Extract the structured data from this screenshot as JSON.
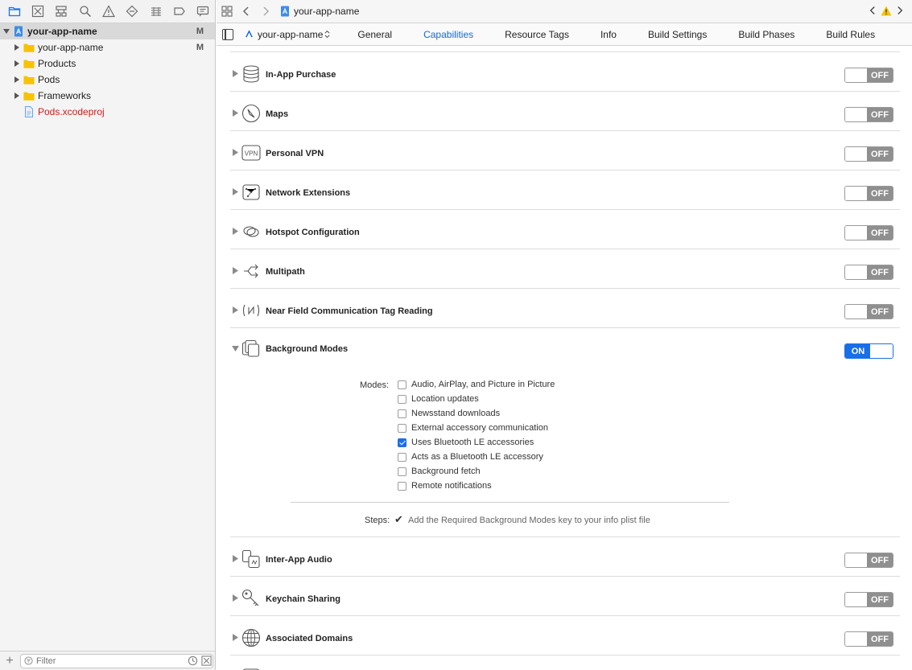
{
  "navigator": {
    "toolbar_icons": [
      "folder-icon",
      "source-control-icon",
      "hierarchy-icon",
      "find-icon",
      "warning-icon",
      "test-icon",
      "debug-icon",
      "breakpoint-icon",
      "report-icon"
    ],
    "tree": [
      {
        "label": "your-app-name",
        "badge": "M",
        "type": "project",
        "level": 0,
        "expanded": true,
        "selected": true
      },
      {
        "label": "your-app-name",
        "badge": "M",
        "type": "folder",
        "level": 1,
        "expanded": false
      },
      {
        "label": "Products",
        "badge": "",
        "type": "folder",
        "level": 1,
        "expanded": false
      },
      {
        "label": "Pods",
        "badge": "",
        "type": "folder",
        "level": 1,
        "expanded": false
      },
      {
        "label": "Frameworks",
        "badge": "",
        "type": "folder",
        "level": 1,
        "expanded": false
      },
      {
        "label": "Pods.xcodeproj",
        "badge": "",
        "type": "file",
        "level": 1,
        "color": "#d01b1b"
      }
    ],
    "filter_placeholder": "Filter"
  },
  "jumpbar": {
    "title": "your-app-name"
  },
  "tabs": {
    "target": "your-app-name",
    "items": [
      "General",
      "Capabilities",
      "Resource Tags",
      "Info",
      "Build Settings",
      "Build Phases",
      "Build Rules"
    ],
    "active": "Capabilities"
  },
  "capabilities": [
    {
      "title": "In-App Purchase",
      "state": "OFF",
      "icon": "coins-icon"
    },
    {
      "title": "Maps",
      "state": "OFF",
      "icon": "compass-icon"
    },
    {
      "title": "Personal VPN",
      "state": "OFF",
      "icon": "vpn-icon"
    },
    {
      "title": "Network Extensions",
      "state": "OFF",
      "icon": "network-extension-icon"
    },
    {
      "title": "Hotspot Configuration",
      "state": "OFF",
      "icon": "hotspot-icon"
    },
    {
      "title": "Multipath",
      "state": "OFF",
      "icon": "multipath-icon"
    },
    {
      "title": "Near Field Communication Tag Reading",
      "state": "OFF",
      "icon": "nfc-icon"
    },
    {
      "title": "Background Modes",
      "state": "ON",
      "icon": "background-modes-icon"
    },
    {
      "title": "Inter-App Audio",
      "state": "OFF",
      "icon": "inter-app-audio-icon"
    },
    {
      "title": "Keychain Sharing",
      "state": "OFF",
      "icon": "keychain-icon"
    },
    {
      "title": "Associated Domains",
      "state": "OFF",
      "icon": "globe-icon"
    },
    {
      "title": "",
      "state": "OFF",
      "icon": "next-capability-icon"
    }
  ],
  "background_modes": {
    "modes_label": "Modes:",
    "modes": [
      {
        "label": "Audio, AirPlay, and Picture in Picture",
        "checked": false
      },
      {
        "label": "Location updates",
        "checked": false
      },
      {
        "label": "Newsstand downloads",
        "checked": false
      },
      {
        "label": "External accessory communication",
        "checked": false
      },
      {
        "label": "Uses Bluetooth LE accessories",
        "checked": true
      },
      {
        "label": "Acts as a Bluetooth LE accessory",
        "checked": false
      },
      {
        "label": "Background fetch",
        "checked": false
      },
      {
        "label": "Remote notifications",
        "checked": false
      }
    ],
    "steps_label": "Steps:",
    "steps_text": "Add the Required Background Modes key to your info plist file"
  },
  "colors": {
    "accent": "#1a6fe8",
    "toggle_off": "#8f8f8f",
    "warning": "#f5c400"
  }
}
